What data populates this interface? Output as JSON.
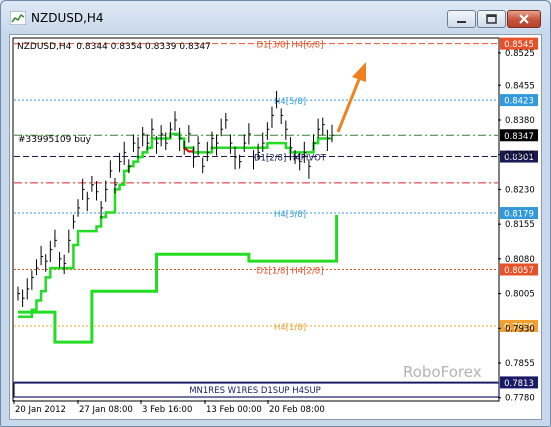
{
  "window": {
    "title": "NZDUSD,H4",
    "buttons": [
      "minimize",
      "maximize",
      "close"
    ]
  },
  "chart_header": {
    "symbol": "NZDUSD,H4",
    "ohlc": "0.8344 0.8354 0.8339 0.8347"
  },
  "order_label": "#33995109 buy",
  "watermark": "RoboForex",
  "bottom_bar_label": "MN1RES W1RES D1SUP H4SUP",
  "colors": {
    "price_line": "#000000",
    "trail_line": "#22dd22",
    "down_segment": "#dd0000",
    "arrow": "#f08020",
    "resistance": "#e8502a",
    "support_blue": "#3399dd",
    "level_orange": "#f0a030",
    "pivot": "#1a1a55",
    "bottom_bar": "#1a1a66"
  },
  "chart_data": {
    "type": "line",
    "ylim": [
      0.7775,
      0.8555
    ],
    "y_ticks": [
      "0.8525",
      "0.8455",
      "0.8380",
      "0.8305",
      "0.8230",
      "0.8155",
      "0.8080",
      "0.8005",
      "0.7930",
      "0.7855",
      "0.7780"
    ],
    "x_ticks": [
      "20 Jan 2012",
      "27 Jan 08:00",
      "3 Feb 16:00",
      "13 Feb 00:00",
      "20 Feb 08:00"
    ],
    "levels": [
      {
        "price": 0.8545,
        "label": "D1[3/8] H4[6/8]",
        "tag": "0.8545",
        "color": "#e8502a",
        "style": "dash",
        "tagbg": "#e8502a",
        "labelcolor": "#e8502a"
      },
      {
        "price": 0.8423,
        "label": "H4[5/8]",
        "tag": "0.8423",
        "color": "#3399dd",
        "style": "dot",
        "tagbg": "#3399dd",
        "labelcolor": "#3399dd"
      },
      {
        "price": 0.8347,
        "label": "",
        "tag": "0.8347",
        "color": "#2a8a2a",
        "style": "dashdot",
        "tagbg": "#000000",
        "labelcolor": "#000000"
      },
      {
        "price": 0.8301,
        "label": "D1[2/8] H4PIVOT",
        "tag": "0.8301",
        "color": "#1a1a55",
        "style": "dash",
        "tagbg": "#1a1a55",
        "labelcolor": "#1a1a55"
      },
      {
        "price": 0.8244,
        "label": "",
        "tag": "",
        "color": "#dd2222",
        "style": "dashdot",
        "tagbg": "",
        "labelcolor": ""
      },
      {
        "price": 0.8179,
        "label": "H4[3/8]",
        "tag": "0.8179",
        "color": "#3399dd",
        "style": "dot",
        "tagbg": "#3399dd",
        "labelcolor": "#3399dd"
      },
      {
        "price": 0.8057,
        "label": "D1[1/8] H4[2/8]",
        "tag": "0.8057",
        "color": "#e8502a",
        "style": "dot",
        "tagbg": "#e8502a",
        "labelcolor": "#e8502a"
      },
      {
        "price": 0.7935,
        "label": "H4[1/8]",
        "tag": "0.7935",
        "color": "#f0a030",
        "style": "dot",
        "tagbg": "#f0a030",
        "labelcolor": "#f0a030"
      },
      {
        "price": 0.7813,
        "label": "",
        "tag": "0.7813",
        "color": "#1a1a66",
        "style": "solid",
        "tagbg": "#1a1a66",
        "labelcolor": "#1a1a66"
      }
    ],
    "price_series": [
      0.8005,
      0.7995,
      0.8015,
      0.804,
      0.806,
      0.8085,
      0.8075,
      0.81,
      0.812,
      0.808,
      0.807,
      0.812,
      0.816,
      0.819,
      0.823,
      0.821,
      0.824,
      0.8225,
      0.819,
      0.823,
      0.827,
      0.824,
      0.829,
      0.831,
      0.828,
      0.833,
      0.832,
      0.835,
      0.833,
      0.836,
      0.833,
      0.835,
      0.833,
      0.836,
      0.838,
      0.834,
      0.832,
      0.835,
      0.83,
      0.833,
      0.828,
      0.831,
      0.834,
      0.833,
      0.836,
      0.838,
      0.833,
      0.83,
      0.829,
      0.833,
      0.835,
      0.83,
      0.831,
      0.833,
      0.836,
      0.839,
      0.842,
      0.839,
      0.836,
      0.832,
      0.83,
      0.829,
      0.831,
      0.828,
      0.833,
      0.836,
      0.837,
      0.834,
      0.8347
    ],
    "trail_series": [
      0.7955,
      0.7955,
      0.7955,
      0.797,
      0.799,
      0.801,
      0.804,
      0.806,
      0.806,
      0.806,
      0.806,
      0.806,
      0.811,
      0.814,
      0.814,
      0.814,
      0.814,
      0.815,
      0.817,
      0.818,
      0.818,
      0.823,
      0.824,
      0.827,
      0.828,
      0.829,
      0.83,
      0.831,
      0.832,
      0.834,
      0.834,
      0.834,
      0.834,
      0.835,
      0.835,
      0.834,
      0.832,
      0.832,
      0.831,
      0.831,
      0.831,
      0.831,
      0.832,
      0.832,
      0.832,
      0.832,
      0.832,
      0.832,
      0.832,
      0.832,
      0.832,
      0.832,
      0.832,
      0.832,
      0.833,
      0.833,
      0.833,
      0.833,
      0.832,
      0.831,
      0.831,
      0.831,
      0.831,
      0.831,
      0.833,
      0.834,
      0.834,
      0.834,
      0.834
    ],
    "lower_trail": [
      {
        "from": 0,
        "to": 8,
        "price": 0.7965
      },
      {
        "from": 8,
        "to": 16,
        "price": 0.79
      },
      {
        "from": 16,
        "to": 30,
        "price": 0.801
      },
      {
        "from": 30,
        "to": 50,
        "price": 0.809
      },
      {
        "from": 50,
        "to": 69,
        "price": 0.8075
      }
    ]
  }
}
